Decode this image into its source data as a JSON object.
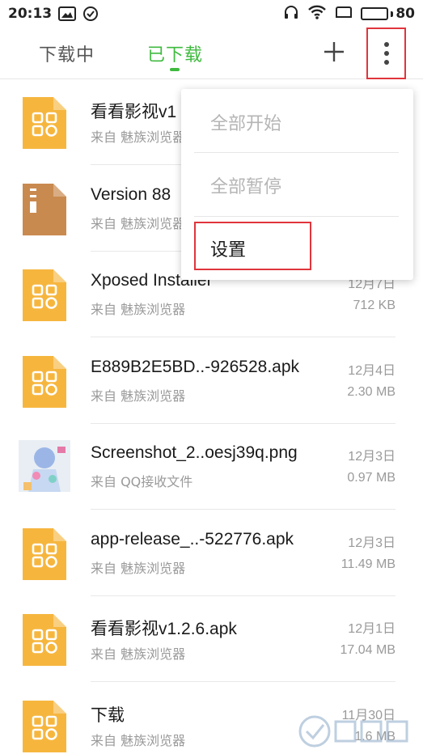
{
  "status_bar": {
    "time": "20:13",
    "battery": "80",
    "battery_level": 0.8
  },
  "tabs": {
    "downloading": "下载中",
    "downloaded": "已下载"
  },
  "menu": {
    "items": [
      {
        "label": "全部开始",
        "enabled": false
      },
      {
        "label": "全部暂停",
        "enabled": false
      },
      {
        "label": "设置",
        "enabled": true
      }
    ]
  },
  "files": [
    {
      "name": "看看影视v1",
      "source": "来自 魅族浏览器",
      "date": "",
      "size": "",
      "icon": "apk-file-icon"
    },
    {
      "name": "Version 88",
      "source": "来自 魅族浏览器",
      "date": "",
      "size": "",
      "icon": "archive-file-icon"
    },
    {
      "name": "Xposed Installer",
      "source": "来自 魅族浏览器",
      "date": "12月7日",
      "size": "712 KB",
      "icon": "apk-file-icon"
    },
    {
      "name": "E889B2E5BD..-926528.apk",
      "source": "来自 魅族浏览器",
      "date": "12月4日",
      "size": "2.30 MB",
      "icon": "apk-file-icon"
    },
    {
      "name": "Screenshot_2..oesj39q.png",
      "source": "来自 QQ接收文件",
      "date": "12月3日",
      "size": "0.97 MB",
      "icon": "image-thumbnail"
    },
    {
      "name": "app-release_..-522776.apk",
      "source": "来自 魅族浏览器",
      "date": "12月3日",
      "size": "11.49 MB",
      "icon": "apk-file-icon"
    },
    {
      "name": "看看影视v1.2.6.apk",
      "source": "来自 魅族浏览器",
      "date": "12月1日",
      "size": "17.04 MB",
      "icon": "apk-file-icon"
    },
    {
      "name": "下载",
      "source": "来自 魅族浏览器",
      "date": "11月30日",
      "size": "1.6 MB",
      "icon": "apk-file-icon"
    }
  ],
  "colors": {
    "accent": "#3fba3f",
    "apk_icon": "#f6b63e",
    "archive_icon": "#c98a4f",
    "highlight": "#e0353c"
  }
}
